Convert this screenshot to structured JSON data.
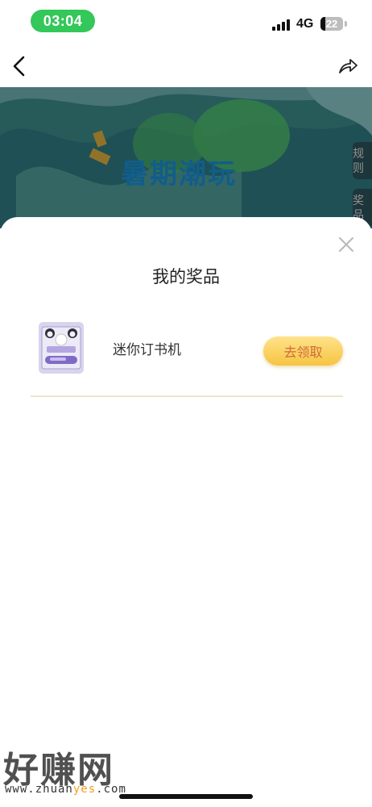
{
  "status_bar": {
    "time": "03:04",
    "network": "4G",
    "battery": "22"
  },
  "banner": {
    "title": "暑期潮玩",
    "side_tabs": [
      "规则",
      "奖品"
    ]
  },
  "sheet": {
    "title": "我的奖品",
    "prizes": [
      {
        "name": "迷你订书机",
        "action": "去领取"
      }
    ]
  },
  "watermark": {
    "brand": "好赚网",
    "url_prefix": "www.zhuan",
    "url_highlight": "yes",
    "url_suffix": ".com"
  },
  "colors": {
    "claim_button": "#f5c542",
    "claim_text": "#d06a3a",
    "time_pill": "#34c759"
  },
  "icons": {
    "back": "chevron-left-icon",
    "share": "share-arrow-icon",
    "close": "close-x-icon"
  }
}
